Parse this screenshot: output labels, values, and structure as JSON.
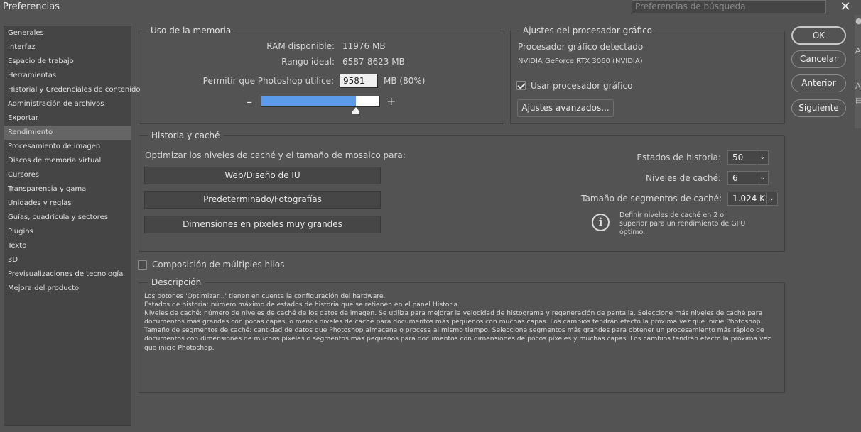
{
  "window": {
    "title": "Preferencias",
    "search_placeholder": "Preferencias de búsqueda",
    "close_glyph": "✕"
  },
  "edge_glyphs": [
    "●",
    "A",
    "A",
    "▤"
  ],
  "sidebar": {
    "items": [
      {
        "label": "Generales"
      },
      {
        "label": "Interfaz"
      },
      {
        "label": "Espacio de trabajo"
      },
      {
        "label": "Herramientas"
      },
      {
        "label": "Historial y Credenciales de contenido"
      },
      {
        "label": "Administración de archivos"
      },
      {
        "label": "Exportar"
      },
      {
        "label": "Rendimiento",
        "active": true
      },
      {
        "label": "Procesamiento de imagen"
      },
      {
        "label": "Discos de memoria virtual"
      },
      {
        "label": "Cursores"
      },
      {
        "label": "Transparencia y gama"
      },
      {
        "label": "Unidades y reglas"
      },
      {
        "label": "Guías, cuadrícula y sectores"
      },
      {
        "label": "Plugins"
      },
      {
        "label": "Texto"
      },
      {
        "label": "3D"
      },
      {
        "label": "Previsualizaciones de tecnología"
      },
      {
        "label": "Mejora del producto"
      }
    ]
  },
  "memory": {
    "title": "Uso de la memoria",
    "ram_label": "RAM disponible:",
    "ram_value": "11976 MB",
    "range_label": "Rango ideal:",
    "range_value": "6587-8623 MB",
    "allow_label": "Permitir que Photoshop utilice:",
    "allow_value": "9581",
    "allow_unit": "MB (80%)",
    "slider_fraction": 0.8,
    "minus": "–",
    "plus": "+"
  },
  "gpu": {
    "title": "Ajustes del procesador gráfico",
    "detected_label": "Procesador gráfico detectado",
    "detected_value": "NVIDIA GeForce RTX 3060 (NVIDIA)",
    "use_gpu_label": "Usar procesador gráfico",
    "use_gpu_checked": true,
    "advanced_button": "Ajustes avanzados..."
  },
  "history": {
    "title": "Historia y caché",
    "optimize_label": "Optimizar los niveles de caché y el tamaño de mosaico para:",
    "buttons": [
      "Web/Diseño de IU",
      "Predeterminado/Fotografías",
      "Dimensiones en píxeles muy grandes"
    ],
    "states_label": "Estados de historia:",
    "states_value": "50",
    "cache_levels_label": "Niveles de caché:",
    "cache_levels_value": "6",
    "tile_size_label": "Tamaño de segmentos de caché:",
    "tile_size_value": "1.024 K",
    "info_text": "Definir niveles de caché en 2 o superior para un rendimiento de GPU óptimo."
  },
  "multithread": {
    "label": "Composición de múltiples hilos",
    "checked": false
  },
  "description": {
    "title": "Descripción",
    "lines": [
      "Los botones 'Optimizar...' tienen en cuenta la configuración del hardware.",
      "Estados de historia: número máximo de estados de historia que se retienen en el panel Historia.",
      "Niveles de caché: número de niveles de caché de los datos de imagen. Se utiliza para mejorar la velocidad de histograma y regeneración de pantalla. Seleccione más niveles de caché para documentos más grandes con pocas capas, o menos niveles de caché para documentos más pequeños con muchas capas. Los cambios tendrán efecto la próxima vez que inicie Photoshop.",
      "Tamaño de segmentos de caché: cantidad de datos que Photoshop almacena o procesa al mismo tiempo. Seleccione segmentos más grandes para obtener un procesamiento más rápido de documentos con dimensiones de muchos píxeles o segmentos más pequeños para documentos con dimensiones de pocos píxeles y muchas capas. Los cambios tendrán efecto la próxima vez que inicie Photoshop."
    ]
  },
  "actions": {
    "ok": "OK",
    "cancel": "Cancelar",
    "previous": "Anterior",
    "next": "Siguiente"
  },
  "colors": {
    "background": "#535353",
    "slider_fill": "#5b9bea",
    "panel": "#454545"
  }
}
